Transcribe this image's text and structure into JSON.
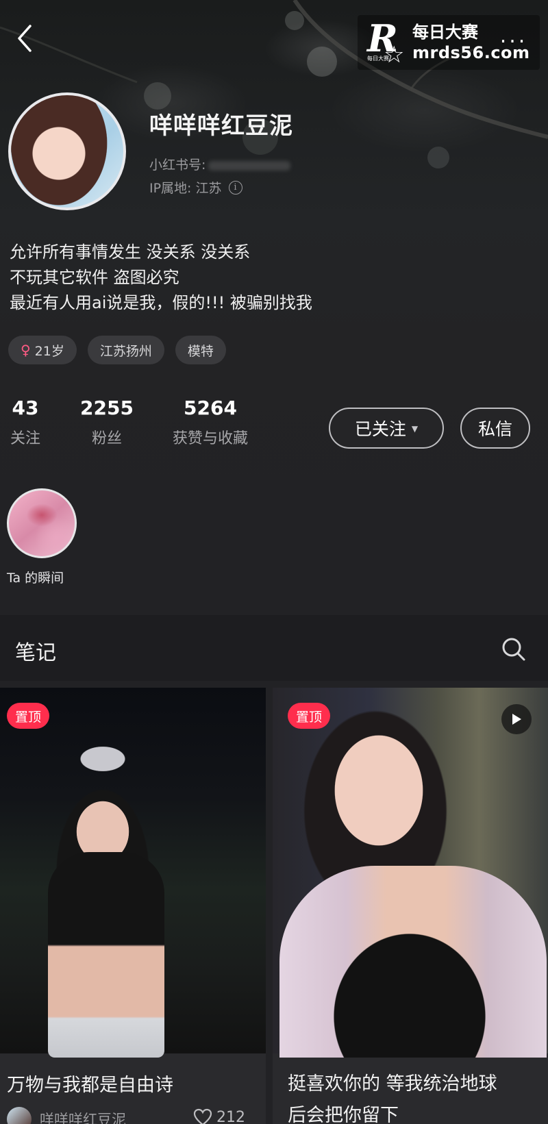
{
  "header": {
    "more_label": "...",
    "watermark": {
      "logo_letter": "R",
      "logo_small_text": "每日大赛",
      "name": "每日大赛",
      "url": "mrds56.com"
    }
  },
  "profile": {
    "nickname": "咩咩咩红豆泥",
    "red_id_label": "小红书号:",
    "ip_location": "IP属地: 江苏",
    "bio": [
      "允许所有事情发生  没关系 没关系",
      "不玩其它软件 盗图必究",
      "最近有人用ai说是我，假的!!!  被骗别找我"
    ],
    "tags": [
      {
        "icon": "female-icon",
        "label": "21岁"
      },
      {
        "label": "江苏扬州"
      },
      {
        "label": "模特"
      }
    ],
    "stats": [
      {
        "value": "43",
        "label": "关注"
      },
      {
        "value": "2255",
        "label": "粉丝"
      },
      {
        "value": "5264",
        "label": "获赞与收藏"
      }
    ],
    "follow_button": "已关注",
    "message_button": "私信",
    "moment_label": "Ta 的瞬间"
  },
  "notes": {
    "title": "笔记",
    "cards": [
      {
        "pinned_label": "置顶",
        "title": "万物与我都是自由诗",
        "author": "咩咩咩红豆泥",
        "likes": "212",
        "has_video": false
      },
      {
        "pinned_label": "置顶",
        "title_lines": [
          "挺喜欢你的 等我统治地球",
          "后会把你留下"
        ],
        "has_video": true
      }
    ]
  },
  "colors": {
    "background": "#222225",
    "pin_badge": "#ff2e4d",
    "female_icon": "#ff5b84"
  }
}
